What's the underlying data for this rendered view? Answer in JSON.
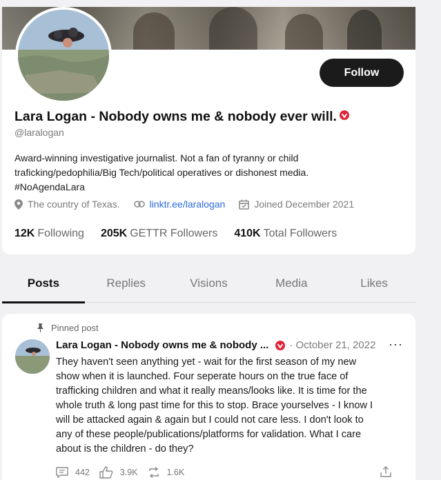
{
  "profile": {
    "display_name": "Lara Logan - Nobody owns me & nobody ever will.",
    "handle": "@laralogan",
    "follow_label": "Follow",
    "bio_lines": [
      "Award-winning investigative journalist. Not a fan of tyranny or child",
      "traficking/pedophilia/Big Tech/political operatives or dishonest media.",
      "#NoAgendaLara"
    ],
    "location": "The country of Texas.",
    "link": "linktr.ee/laralogan",
    "joined": "Joined December 2021",
    "stats": [
      {
        "value": "12K",
        "label": "Following"
      },
      {
        "value": "205K",
        "label": "GETTR Followers"
      },
      {
        "value": "410K",
        "label": "Total Followers"
      }
    ]
  },
  "tabs": [
    "Posts",
    "Replies",
    "Visions",
    "Media",
    "Likes"
  ],
  "active_tab": "Posts",
  "post": {
    "pinned_label": "Pinned post",
    "author": "Lara Logan - Nobody owns me & nobody ...",
    "date": "· October 21, 2022",
    "more": "···",
    "text_lines": [
      "They haven't seen anything yet - wait for the first season of my new",
      "show when it is launched. Four seperate hours on the true face of",
      "trafficking children and what it really means/looks like. It is time for the",
      "whole truth & long past time for this to stop. Brace yourselves - I know I",
      "will be attacked again & again but I could not care less. I don't look to",
      "any of these people/publications/platforms for validation. What I care",
      "about is the children - do they?"
    ],
    "comments": "442",
    "likes": "3.9K",
    "reposts": "1.6K"
  },
  "icons": {
    "verified": "verified-badge-icon",
    "location": "location-pin-icon",
    "link": "link-icon",
    "calendar": "calendar-icon",
    "pin": "pin-icon",
    "comment": "comment-icon",
    "like": "thumbs-up-icon",
    "repost": "repost-icon",
    "share": "share-icon"
  },
  "colors": {
    "accent_link": "#2d6ce0",
    "verified_red": "#e0243a",
    "button_dark": "#1b1b1b"
  }
}
